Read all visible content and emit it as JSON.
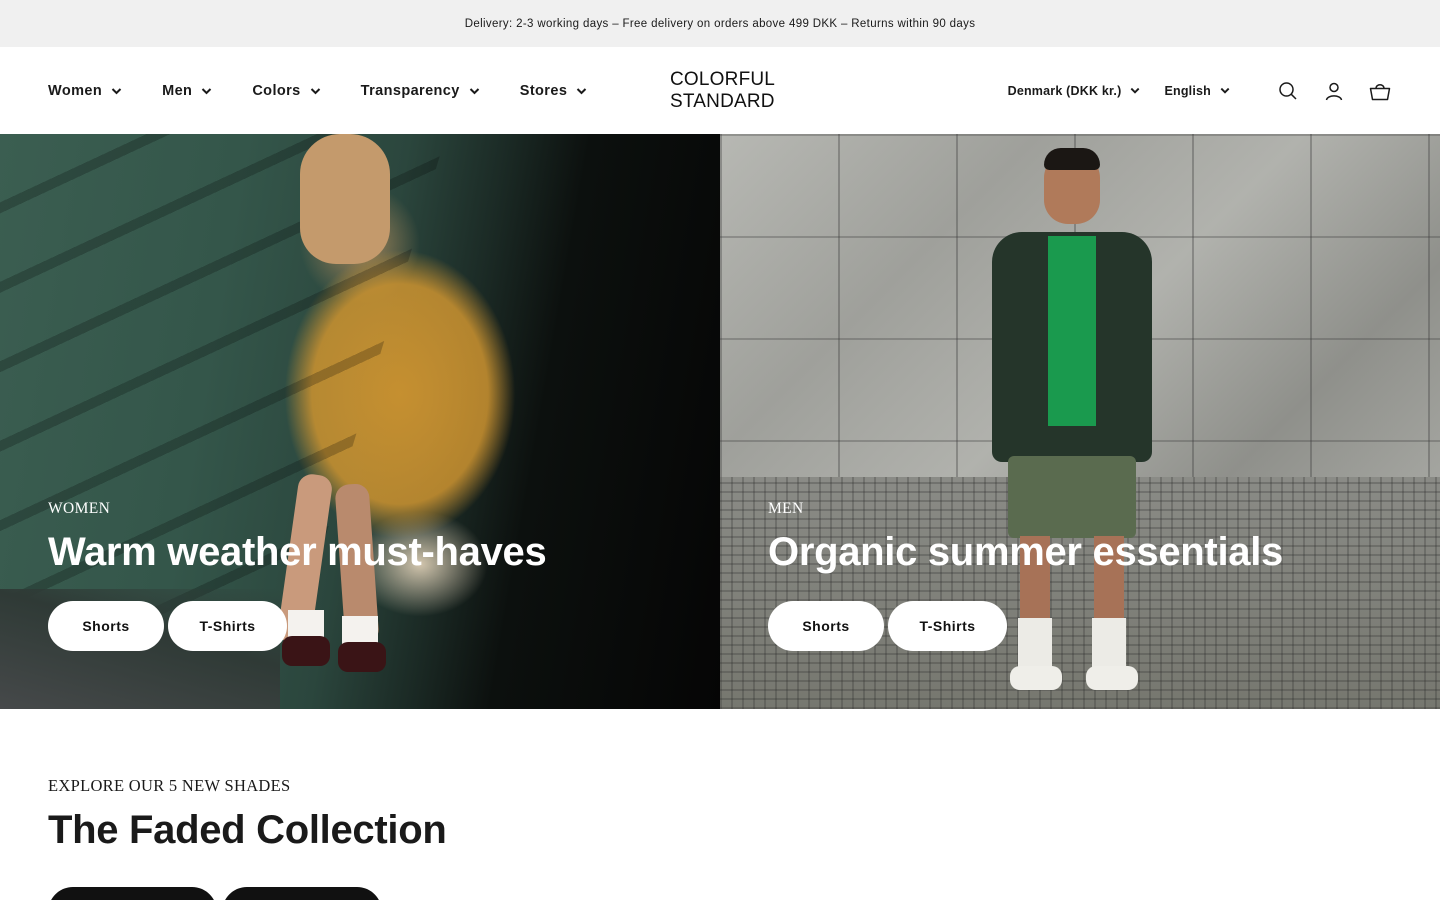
{
  "announcement": {
    "text": "Delivery: 2-3 working days – Free delivery on orders above 499 DKK – Returns within 90 days"
  },
  "brand": {
    "logo_line1": "COLORFUL",
    "logo_line2": "STANDARD"
  },
  "nav": {
    "items": [
      {
        "label": "Women"
      },
      {
        "label": "Men"
      },
      {
        "label": "Colors"
      },
      {
        "label": "Transparency"
      },
      {
        "label": "Stores"
      }
    ]
  },
  "header_right": {
    "country": "Denmark (DKK kr.)",
    "language": "English",
    "icons": [
      "search-icon",
      "account-icon",
      "cart-icon"
    ]
  },
  "hero": {
    "women": {
      "eyebrow": "WOMEN",
      "headline": "Warm weather must-haves",
      "buttons": [
        {
          "label": "Shorts"
        },
        {
          "label": "T-Shirts"
        }
      ]
    },
    "men": {
      "eyebrow": "MEN",
      "headline": "Organic summer essentials",
      "buttons": [
        {
          "label": "Shorts"
        },
        {
          "label": "T-Shirts"
        }
      ]
    }
  },
  "collection": {
    "eyebrow": "EXPLORE OUR 5 NEW SHADES",
    "title": "The Faded Collection"
  },
  "colors": {
    "announcement_bg": "#f0f0f0",
    "text": "#1a1a1a",
    "button_light": "#ffffff",
    "button_dark": "#111111"
  }
}
